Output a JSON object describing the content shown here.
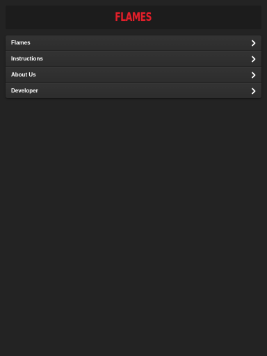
{
  "header": {
    "logo_text": "FLAMES"
  },
  "menu": {
    "items": [
      {
        "label": "Flames"
      },
      {
        "label": "Instructions"
      },
      {
        "label": "About Us"
      },
      {
        "label": "Developer"
      }
    ],
    "icon": "chevron-right-icon"
  },
  "colors": {
    "background": "#232323",
    "header_bg": "#1c1c1c",
    "logo": "#e0202b",
    "menu_bg": "#2e2e2e",
    "text": "#ffffff"
  }
}
